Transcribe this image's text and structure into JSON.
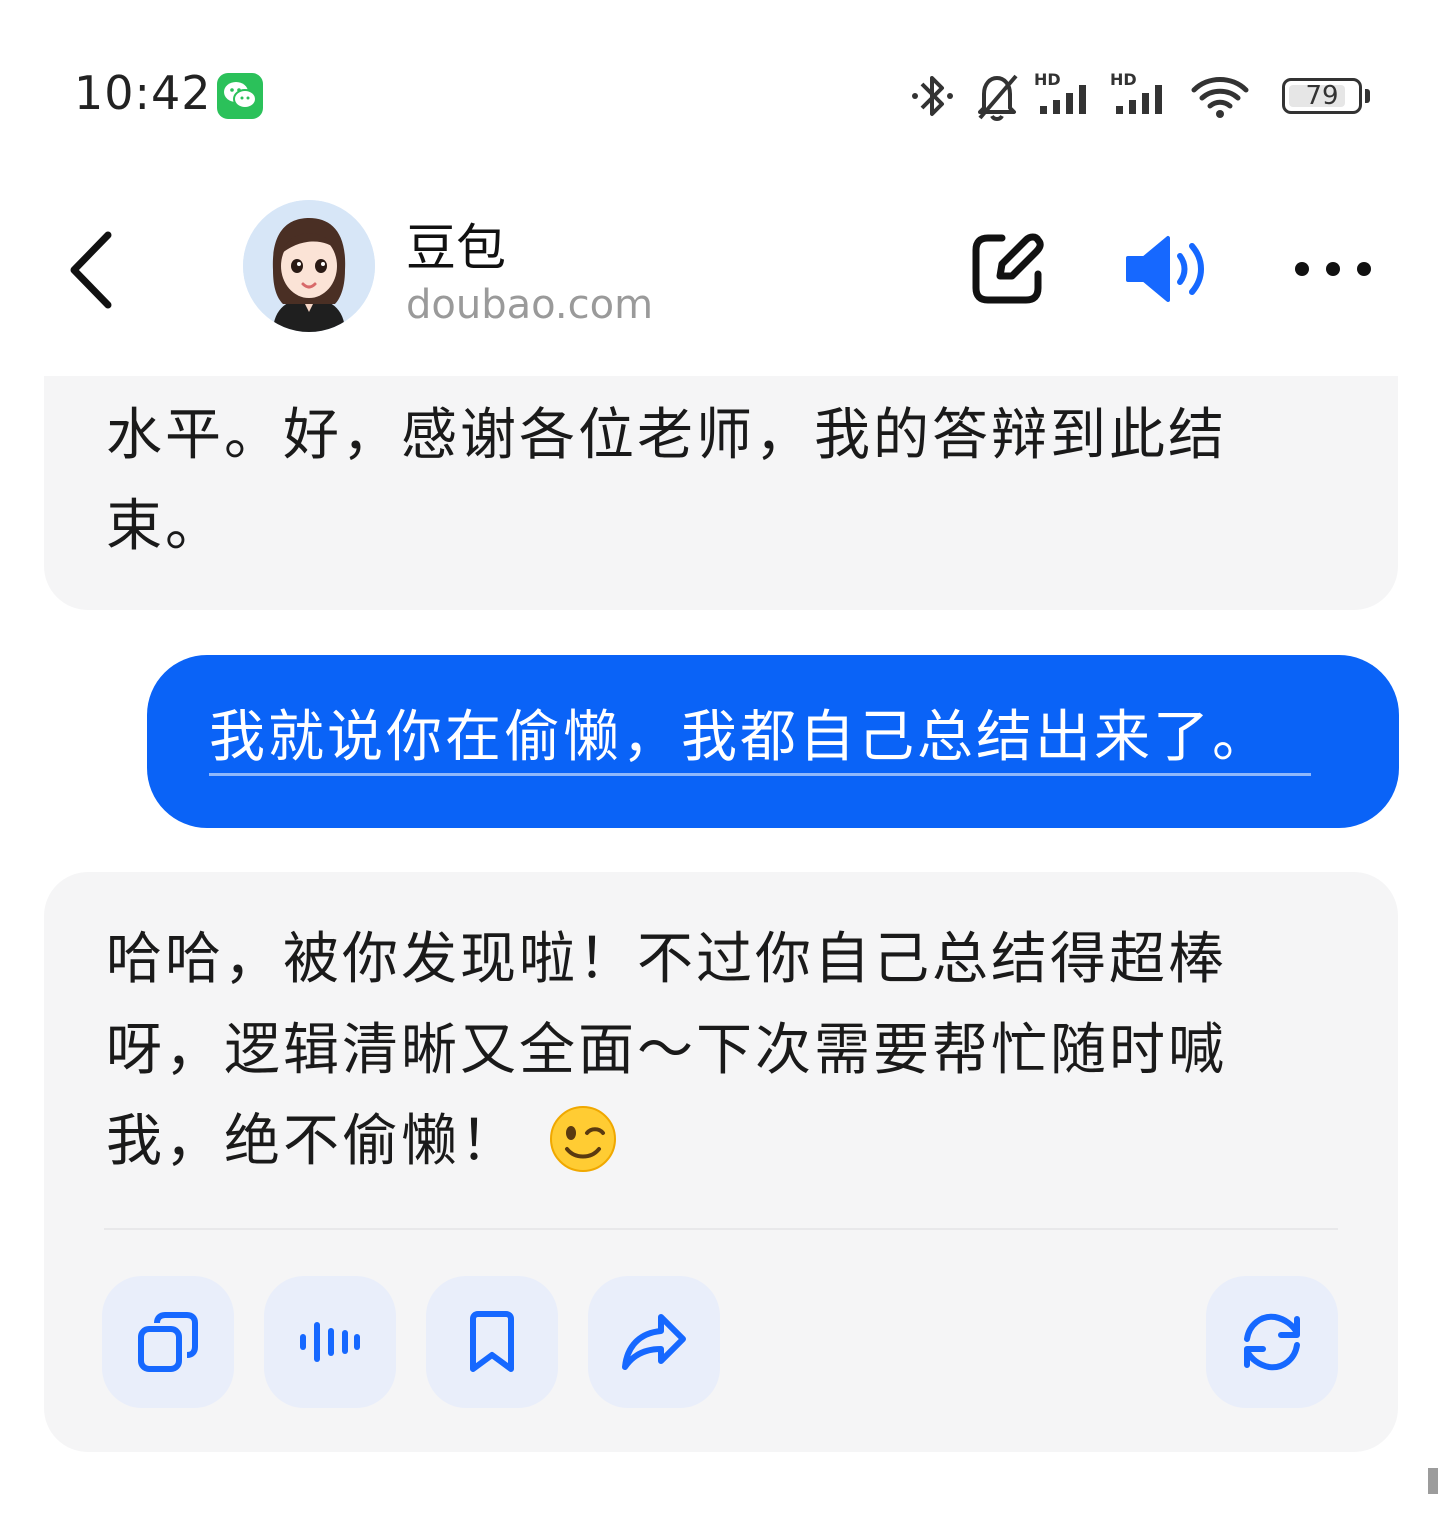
{
  "status_bar": {
    "time": "10:42",
    "notification_icon": "wechat-icon",
    "icons": [
      "bluetooth-icon",
      "bell-muted-icon",
      "hd-signal-icon",
      "hd-signal-icon",
      "wifi-icon"
    ],
    "hd_label": "HD",
    "battery_level": "79"
  },
  "header": {
    "back_icon": "back-icon",
    "avatar_icon": "avatar-icon",
    "bot_name": "豆包",
    "bot_domain": "doubao.com",
    "actions": [
      "edit-icon",
      "speaker-icon",
      "more-icon"
    ],
    "accent_color": "#1668ff"
  },
  "messages": [
    {
      "role": "assistant",
      "text": "水平。好，感谢各位老师，我的答辩到此结束。"
    },
    {
      "role": "user",
      "text": "我就说你在偷懒，我都自己总结出来了。"
    },
    {
      "role": "assistant",
      "text": "哈哈，被你发现啦！不过你自己总结得超棒呀，逻辑清晰又全面～下次需要帮忙随时喊我，绝不偷懒！",
      "emoji": "winking-face-emoji",
      "actions": [
        "copy-icon",
        "read-aloud-icon",
        "bookmark-icon",
        "share-icon",
        "regenerate-icon"
      ]
    }
  ],
  "colors": {
    "user_bubble": "#0a63f7",
    "bot_bubble": "#f5f5f6",
    "action_bg": "#e9eefa",
    "icon_blue": "#1668ff"
  }
}
